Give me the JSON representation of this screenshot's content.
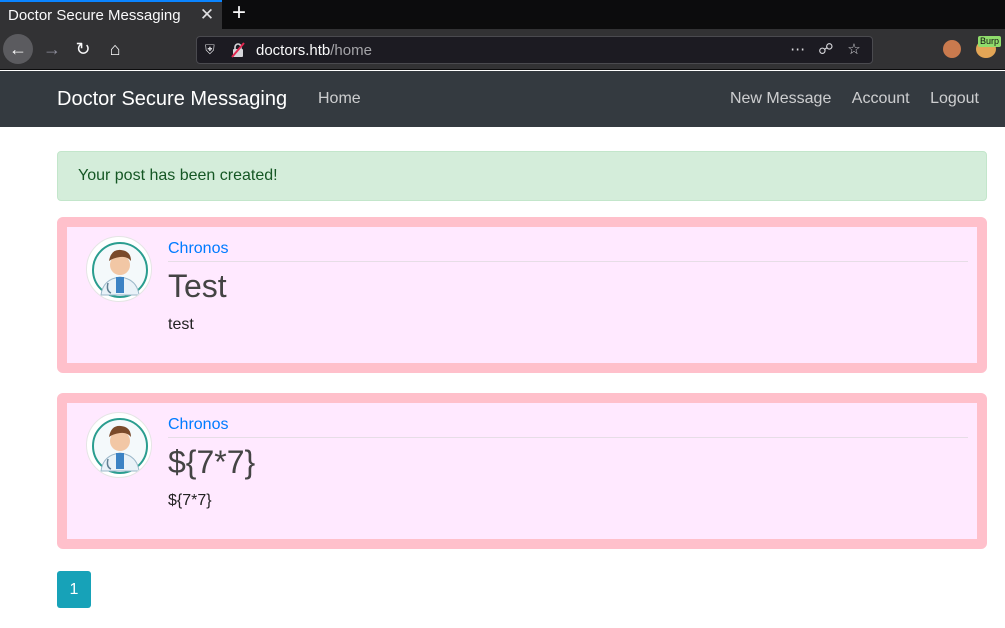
{
  "browser": {
    "tab_title": "Doctor Secure Messaging",
    "tab_close": "✕",
    "new_tab": "+",
    "url_domain": "doctors.htb",
    "url_path": "/home",
    "burp_badge": "Burp"
  },
  "navbar": {
    "brand": "Doctor Secure Messaging",
    "home": "Home",
    "new_message": "New Message",
    "account": "Account",
    "logout": "Logout"
  },
  "alert": {
    "message": "Your post has been created!"
  },
  "posts": [
    {
      "author": "Chronos",
      "title": "Test",
      "content": "test"
    },
    {
      "author": "Chronos",
      "title": "${7*7}",
      "content": "${7*7}"
    }
  ],
  "pagination": {
    "current": "1"
  },
  "colors": {
    "post_border": "#ffc0cb",
    "post_background": "#ffe9ff",
    "link": "#007bff",
    "navbar": "#343a40",
    "pager": "#17a2b8"
  }
}
